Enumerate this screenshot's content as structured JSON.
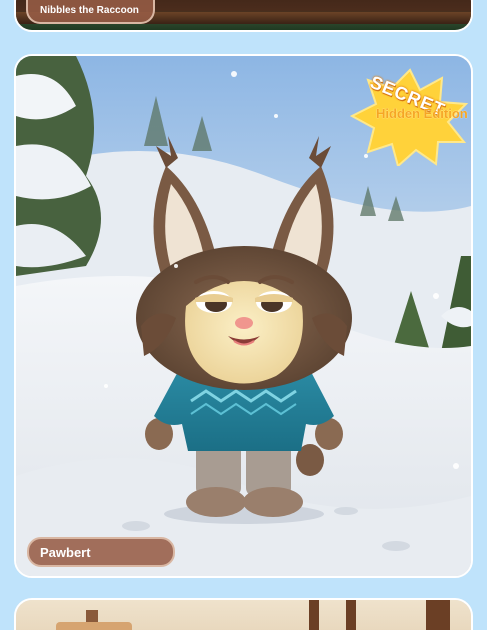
{
  "cards": [
    {
      "name": "Nibbles the Raccoon"
    },
    {
      "name": "Pawbert",
      "badge": {
        "tag": "SECRET",
        "edition": "Hidden Edition"
      }
    },
    {
      "name": ""
    }
  ],
  "colors": {
    "page_background": "#bfe3fb",
    "name_pill": "#965c46",
    "badge_yellow": "#ffd23a",
    "badge_text": "#f6a623"
  },
  "icons": {
    "badge": "starburst-icon"
  }
}
